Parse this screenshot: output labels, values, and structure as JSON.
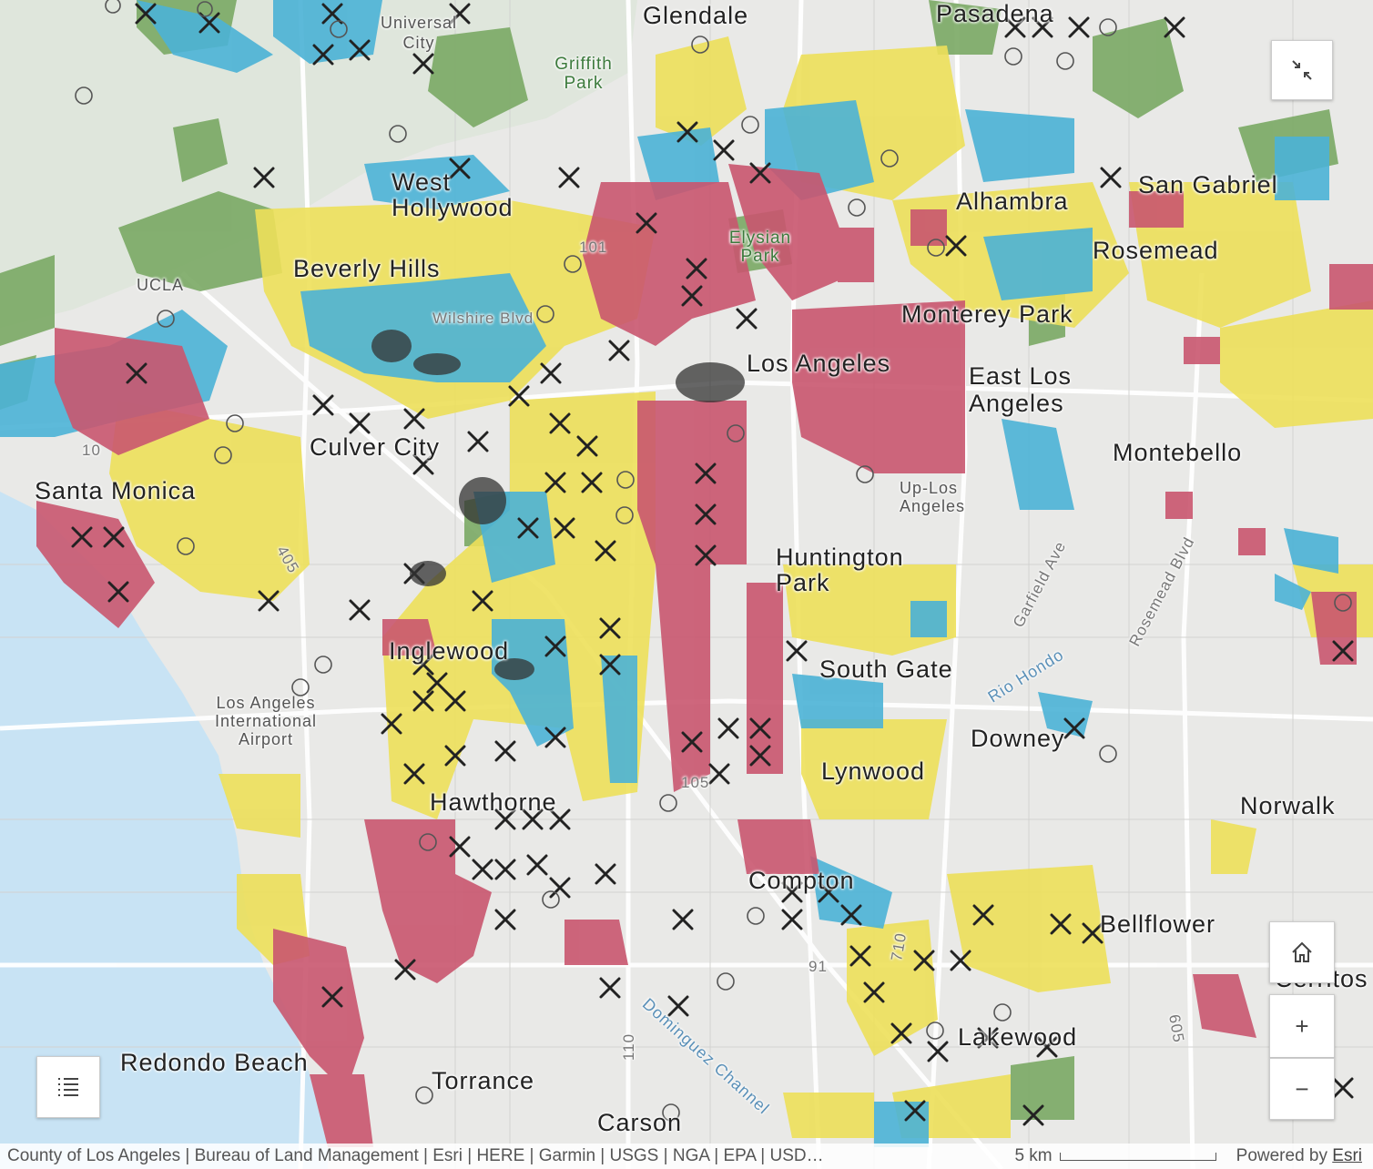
{
  "map": {
    "places": [
      {
        "id": "glendale",
        "name": "Glendale",
        "cls": "big"
      },
      {
        "id": "pasadena",
        "name": "Pasadena",
        "cls": "big"
      },
      {
        "id": "universal-city",
        "name": "Universal City",
        "cls": "small"
      },
      {
        "id": "griffith-park",
        "name": "Griffith Park",
        "cls": "park"
      },
      {
        "id": "west-hollywood",
        "name": "West Hollywood",
        "cls": "big"
      },
      {
        "id": "elysian-park",
        "name": "Elysian Park",
        "cls": "park"
      },
      {
        "id": "alhambra",
        "name": "Alhambra",
        "cls": "big"
      },
      {
        "id": "san-gabriel",
        "name": "San Gabriel",
        "cls": "big"
      },
      {
        "id": "rosemead",
        "name": "Rosemead",
        "cls": "big"
      },
      {
        "id": "beverly-hills",
        "name": "Beverly Hills",
        "cls": "big"
      },
      {
        "id": "ucla",
        "name": "UCLA",
        "cls": "small"
      },
      {
        "id": "wilshire-blvd",
        "name": "Wilshire Blvd",
        "cls": "road"
      },
      {
        "id": "monterey-park",
        "name": "Monterey Park",
        "cls": "big"
      },
      {
        "id": "los-angeles",
        "name": "Los Angeles",
        "cls": "big"
      },
      {
        "id": "east-los-angeles",
        "name": "East Los Angeles",
        "cls": "big"
      },
      {
        "id": "culver-city",
        "name": "Culver City",
        "cls": "big"
      },
      {
        "id": "santa-monica",
        "name": "Santa Monica",
        "cls": "big"
      },
      {
        "id": "montebello",
        "name": "Montebello",
        "cls": "big"
      },
      {
        "id": "huntington-park",
        "name": "Huntington Park",
        "cls": "big"
      },
      {
        "id": "inglewood",
        "name": "Inglewood",
        "cls": "big"
      },
      {
        "id": "south-gate",
        "name": "South Gate",
        "cls": "big"
      },
      {
        "id": "downey",
        "name": "Downey",
        "cls": "big"
      },
      {
        "id": "lax",
        "name": "Los Angeles International Airport",
        "cls": "small"
      },
      {
        "id": "lynwood",
        "name": "Lynwood",
        "cls": "big"
      },
      {
        "id": "hawthorne",
        "name": "Hawthorne",
        "cls": "big"
      },
      {
        "id": "norwalk",
        "name": "Norwalk",
        "cls": "big"
      },
      {
        "id": "compton",
        "name": "Compton",
        "cls": "big"
      },
      {
        "id": "bellflower",
        "name": "Bellflower",
        "cls": "big"
      },
      {
        "id": "lakewood",
        "name": "Lakewood",
        "cls": "big"
      },
      {
        "id": "redondo-beach",
        "name": "Redondo Beach",
        "cls": "big"
      },
      {
        "id": "torrance",
        "name": "Torrance",
        "cls": "big"
      },
      {
        "id": "carson",
        "name": "Carson",
        "cls": "big"
      },
      {
        "id": "cerritos",
        "name": "Cerritos",
        "cls": "big"
      },
      {
        "id": "garfield-ave",
        "name": "Garfield Ave",
        "cls": "road"
      },
      {
        "id": "rosemead-blvd",
        "name": "Rosemead Blvd",
        "cls": "road"
      },
      {
        "id": "rio-hondo",
        "name": "Rio Hondo",
        "cls": "water"
      },
      {
        "id": "dominguez-channel",
        "name": "Dominguez Channel",
        "cls": "water"
      },
      {
        "id": "upper-los-angeles",
        "name": "Up-Los Angeles",
        "cls": "small"
      }
    ],
    "highway_shields": [
      "101",
      "405",
      "10",
      "110",
      "105",
      "91",
      "605",
      "710"
    ],
    "colors": {
      "red": "#c9566f",
      "yellow": "#ede05a",
      "blue": "#4bb2d6",
      "green": "#7aa964",
      "water": "#c8e3f4",
      "land": "#e9e9e7"
    }
  },
  "controls": {
    "fullscreen_exit_icon": "collapse-arrows-icon",
    "home_icon": "home-icon",
    "zoom_in_label": "+",
    "zoom_out_label": "−",
    "legend_icon": "list-icon"
  },
  "attribution": {
    "credits": "County of Los Angeles | Bureau of Land Management | Esri | HERE | Garmin | USGS | NGA | EPA | USD…",
    "scale_label": "5 km",
    "powered_by": "Powered by",
    "esri_link": "Esri"
  }
}
